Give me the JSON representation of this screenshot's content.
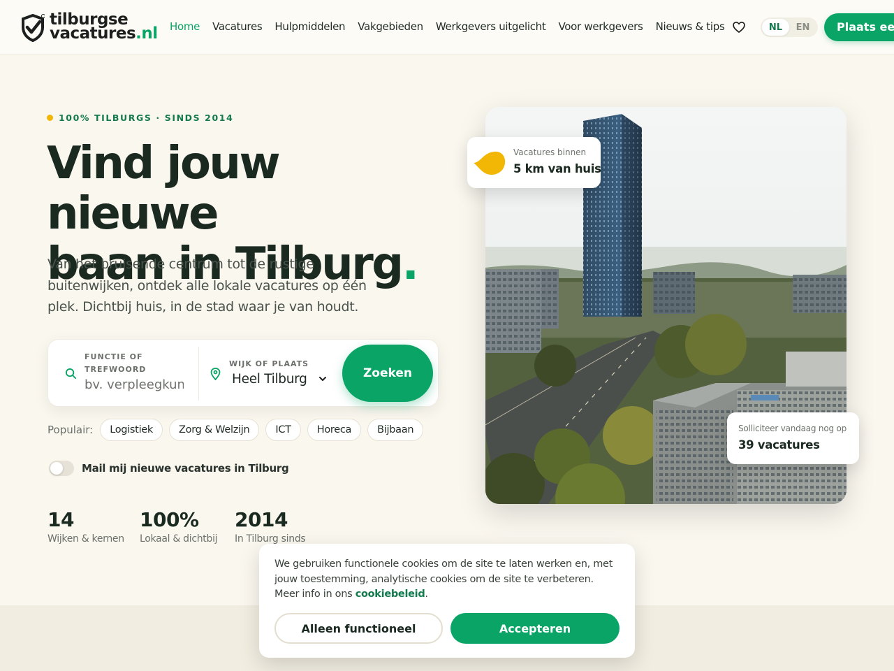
{
  "header": {
    "logo_line1": "tilburgse",
    "logo_line2": "vacatures",
    "logo_suffix": ".nl",
    "nav": [
      {
        "label": "Home",
        "active": true
      },
      {
        "label": "Vacatures"
      },
      {
        "label": "Hulpmiddelen"
      },
      {
        "label": "Vakgebieden"
      },
      {
        "label": "Werkgevers uitgelicht"
      },
      {
        "label": "Voor werkgevers"
      },
      {
        "label": "Nieuws & tips"
      }
    ],
    "lang_nl": "NL",
    "lang_en": "EN",
    "cta": "Plaats een"
  },
  "hero": {
    "eyebrow": "100% TILBURGS · SINDS 2014",
    "title_line1": "Vind jouw nieuwe",
    "title_line2": "baan in Tilburg",
    "title_dot": ".",
    "subtitle": "Van het bruisende centrum tot de rustige buitenwijken, ontdek alle lokale vacatures op één plek. Dichtbij huis, in de stad waar je van houdt."
  },
  "search": {
    "keyword_label": "FUNCTIE OF TREFWOORD",
    "keyword_placeholder": "bv. verpleegkundige",
    "location_label": "WIJK OF PLAATS",
    "location_value": "Heel Tilburg",
    "submit": "Zoeken"
  },
  "popular": {
    "label": "Populair:",
    "chips": [
      "Logistiek",
      "Zorg & Welzijn",
      "ICT",
      "Horeca",
      "Bijbaan"
    ]
  },
  "alert": {
    "label": "Mail mij nieuwe vacatures in Tilburg",
    "enabled": false
  },
  "stats": [
    {
      "value": "14",
      "label": "Wijken & kernen"
    },
    {
      "value": "100%",
      "label": "Lokaal & dichtbij"
    },
    {
      "value": "2014",
      "label": "In Tilburg sinds"
    }
  ],
  "badges": {
    "distance_small": "Vacatures binnen",
    "distance_big": "5 km van huis",
    "today_small": "Solliciteer vandaag nog op",
    "today_big": "39 vacatures"
  },
  "cookie": {
    "text": "We gebruiken functionele cookies om de site te laten werken en, met jouw toestemming, analytische cookies om de site te verbeteren. Meer info in ons ",
    "link": "cookiebeleid",
    "end": ".",
    "btn_functional": "Alleen functioneel",
    "btn_accept": "Accepteren"
  },
  "colors": {
    "accent": "#0aa466",
    "accent_dark": "#137a4e",
    "highlight": "#f2b705",
    "background": "#faf7ef"
  },
  "icons": [
    "shield-check-icon",
    "heart-icon",
    "search-icon",
    "location-pin-icon",
    "chevron-down-icon",
    "leaf-icon"
  ]
}
